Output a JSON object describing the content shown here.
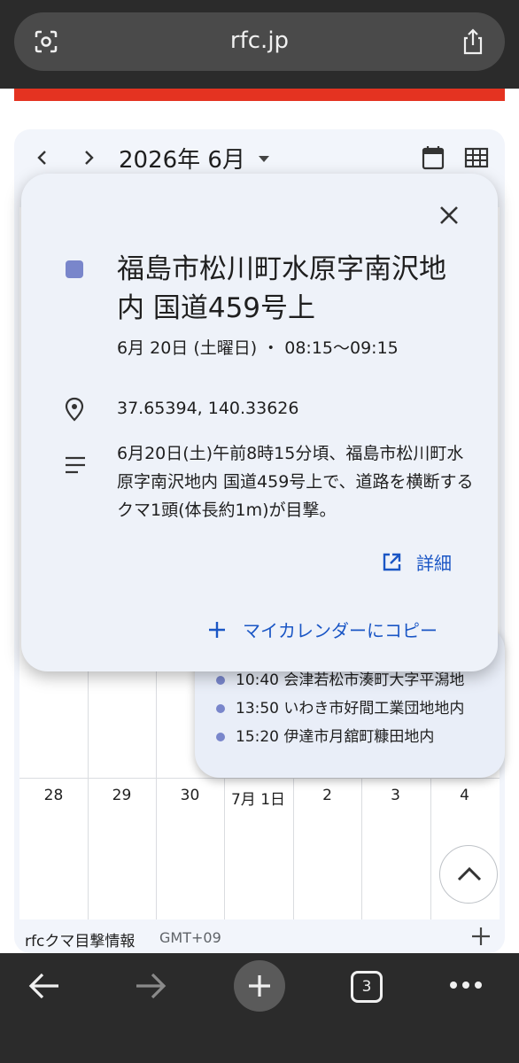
{
  "browser": {
    "url": "rfc.jp",
    "tab_count": "3"
  },
  "calendar": {
    "month_title": "2026年 6月",
    "week_days": [
      "28",
      "29",
      "30",
      "7月 1日",
      "2",
      "3",
      "4"
    ],
    "footer_name": "rfcクマ目撃情報",
    "timezone": "GMT+09"
  },
  "day_popup": {
    "events": [
      {
        "time": "10:40",
        "title": "会津若松市湊町大字平潟地"
      },
      {
        "time": "13:50",
        "title": "いわき市好間工業団地地内"
      },
      {
        "time": "15:20",
        "title": "伊達市月舘町糠田地内"
      }
    ]
  },
  "event": {
    "title": "福島市松川町水原字南沢地内 国道459号上",
    "datetime": "6月 20日 (土曜日) ・ 08:15〜09:15",
    "location": "37.65394, 140.33626",
    "description": "6月20日(土)午前8時15分頃、福島市松川町水原字南沢地内 国道459号上で、道路を横断するクマ1頭(体長約1m)が目撃。",
    "detail_label": "詳細",
    "copy_label": "マイカレンダーにコピー",
    "color": "#7986cb"
  },
  "colors": {
    "accent_red": "#e43321",
    "link_blue": "#1a56c5",
    "browser_bar": "#2b2b2b"
  },
  "icons": [
    "lens-icon",
    "share-icon",
    "chevron-left-icon",
    "chevron-right-icon",
    "calendar-day-icon",
    "calendar-grid-icon",
    "close-icon",
    "location-pin-icon",
    "description-icon",
    "open-external-icon",
    "plus-icon",
    "chevron-up-icon",
    "back-arrow-icon",
    "forward-arrow-icon",
    "more-icon"
  ]
}
